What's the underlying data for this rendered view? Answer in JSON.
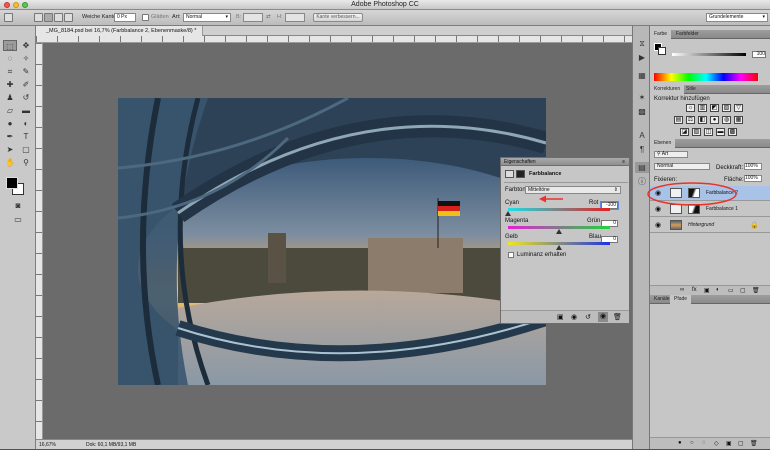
{
  "window": {
    "title": "Adobe Photoshop CC"
  },
  "options_bar": {
    "feather_label": "Weiche Kante:",
    "feather_value": "0 Px",
    "smooth_label": "Glätten",
    "style_label": "Art:",
    "style_value": "Normal",
    "width_label": "B:",
    "height_label": "H:",
    "refine_edge_label": "Kante verbessern...",
    "workspace_value": "Grundelemente"
  },
  "document": {
    "tab_label": "_MG_8184.psd bei 16,7% (Farbbalance 2, Ebenenmaske/8) *",
    "zoom": "16,67%",
    "doc_info": "Dok: 60,1 MB/93,1 MB"
  },
  "properties_panel": {
    "title": "Eigenschaften",
    "adjustment_name": "Farbbalance",
    "tone_label": "Farbton:",
    "tone_value": "Mitteltöne",
    "sliders": [
      {
        "left": "Cyan",
        "right": "Rot",
        "value": "-100",
        "level": 0.0
      },
      {
        "left": "Magenta",
        "right": "Grün",
        "value": "0",
        "level": 0.5
      },
      {
        "left": "Gelb",
        "right": "Blau",
        "value": "0",
        "level": 0.5
      }
    ],
    "preserve_luminosity_label": "Luminanz erhalten"
  },
  "color_panel": {
    "tabs": [
      "Farbe",
      "Farbfelder"
    ],
    "value": "100"
  },
  "corrections_panel": {
    "tabs": [
      "Korrekturen",
      "Stile"
    ],
    "heading": "Korrektur hinzufügen"
  },
  "layers_panel": {
    "tabs": [
      "Ebenen"
    ],
    "filter_value": "Art",
    "blend_mode": "Normal",
    "opacity_label": "Deckkraft:",
    "opacity_value": "100%",
    "lock_label": "Fixieren:",
    "fill_label": "Fläche:",
    "fill_value": "100%",
    "layers": [
      {
        "name": "Farbbalance 2",
        "selected": true
      },
      {
        "name": "Farbbalance 1",
        "selected": false
      },
      {
        "name": "Hintergrund",
        "selected": false
      }
    ]
  },
  "bottom_panel": {
    "tabs": [
      "Kanäle",
      "Pfade"
    ]
  },
  "colors": {
    "accent_red": "#e8332a",
    "selection_blue": "#a9c2e8"
  }
}
